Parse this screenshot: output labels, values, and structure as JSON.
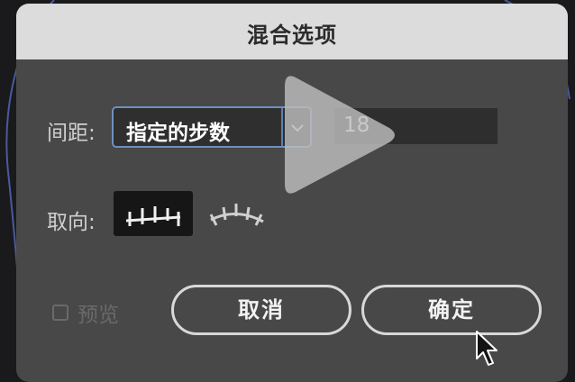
{
  "dialog": {
    "title": "混合选项"
  },
  "spacing": {
    "label": "间距:",
    "mode_value": "指定的步数",
    "steps_value": "18"
  },
  "orientation": {
    "label": "取向:",
    "options": [
      {
        "icon": "align-to-page-icon",
        "selected": true
      },
      {
        "icon": "align-to-path-icon",
        "selected": false
      }
    ]
  },
  "preview": {
    "label": "预览",
    "checked": false
  },
  "buttons": {
    "cancel_label": "取消",
    "ok_label": "确定"
  },
  "colors": {
    "titlebar": "#dcdcdc",
    "dialog_bg": "#484848",
    "select_border": "#6f8fbf",
    "button_border": "#d8d8d8"
  }
}
